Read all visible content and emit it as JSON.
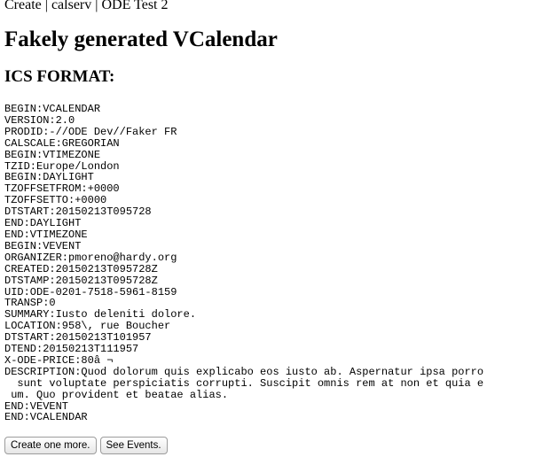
{
  "breadcrumb": "Create | calserv | ODE Test 2",
  "page_title": "Fakely generated VCalendar",
  "section_title": "ICS FORMAT:",
  "ics_lines": [
    "BEGIN:VCALENDAR",
    "VERSION:2.0",
    "PRODID:-//ODE Dev//Faker FR",
    "CALSCALE:GREGORIAN",
    "BEGIN:VTIMEZONE",
    "TZID:Europe/London",
    "BEGIN:DAYLIGHT",
    "TZOFFSETFROM:+0000",
    "TZOFFSETTO:+0000",
    "DTSTART:20150213T095728",
    "END:DAYLIGHT",
    "END:VTIMEZONE",
    "BEGIN:VEVENT",
    "ORGANIZER:pmoreno@hardy.org",
    "CREATED:20150213T095728Z",
    "DTSTAMP:20150213T095728Z",
    "UID:ODE-0201-7518-5961-8159",
    "TRANSP:0",
    "SUMMARY:Iusto deleniti dolore.",
    "LOCATION:958\\, rue Boucher",
    "DTSTART:20150213T101957",
    "DTEND:20150213T111957",
    "X-ODE-PRICE:80â ¬",
    "DESCRIPTION:Quod dolorum quis explicabo eos iusto ab. Aspernatur ipsa porro",
    "  sunt voluptate perspiciatis corrupti. Suscipit omnis rem at non et quia e",
    " um. Quo provident et beatae alias.",
    "END:VEVENT",
    "END:VCALENDAR"
  ],
  "buttons": {
    "create_more": "Create one more.",
    "see_events": "See Events."
  }
}
